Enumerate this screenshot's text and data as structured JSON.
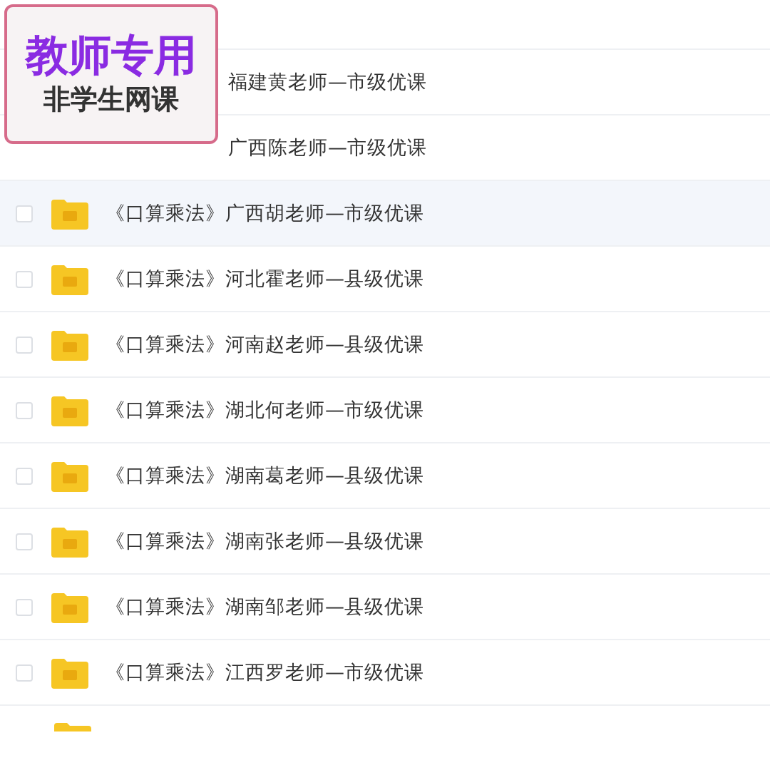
{
  "badge": {
    "title": "教师专用",
    "subtitle": "非学生网课"
  },
  "rows": [
    {
      "kind": "covered",
      "name": "福建黄老师—市级优课",
      "highlighted": false
    },
    {
      "kind": "covered",
      "name": "广西陈老师—市级优课",
      "highlighted": false
    },
    {
      "kind": "file",
      "name": "《口算乘法》广西胡老师—市级优课",
      "checked": false,
      "highlighted": true
    },
    {
      "kind": "file",
      "name": "《口算乘法》河北霍老师—县级优课",
      "checked": false,
      "highlighted": false
    },
    {
      "kind": "file",
      "name": "《口算乘法》河南赵老师—县级优课",
      "checked": false,
      "highlighted": false
    },
    {
      "kind": "file",
      "name": "《口算乘法》湖北何老师—市级优课",
      "checked": false,
      "highlighted": false
    },
    {
      "kind": "file",
      "name": "《口算乘法》湖南葛老师—县级优课",
      "checked": false,
      "highlighted": false
    },
    {
      "kind": "file",
      "name": "《口算乘法》湖南张老师—县级优课",
      "checked": false,
      "highlighted": false
    },
    {
      "kind": "file",
      "name": "《口算乘法》湖南邹老师—县级优课",
      "checked": false,
      "highlighted": false
    },
    {
      "kind": "file",
      "name": "《口算乘法》江西罗老师—市级优课",
      "checked": false,
      "highlighted": false
    }
  ]
}
